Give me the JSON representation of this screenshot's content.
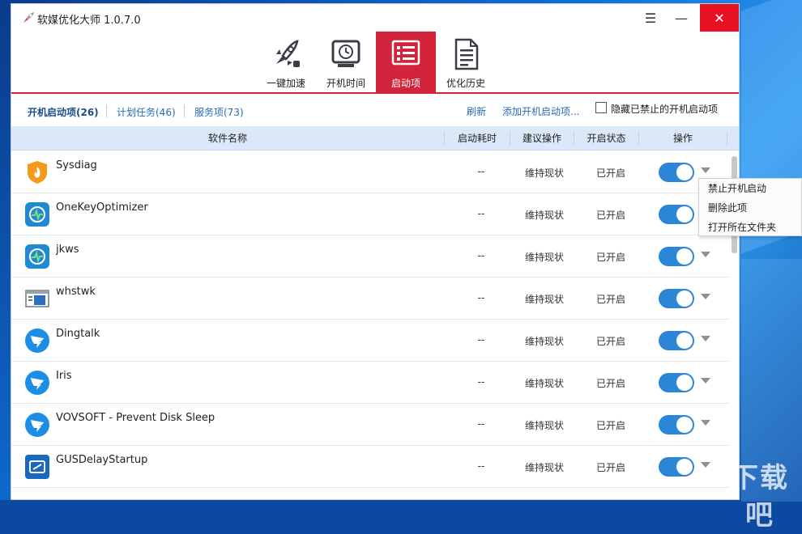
{
  "window": {
    "title": "软媒优化大师 1.0.7.0",
    "menu_glyph": "☰",
    "minimize_glyph": "—",
    "close_glyph": "✕"
  },
  "toolbar": {
    "items": [
      {
        "label": "一键加速",
        "icon": "rocket-icon"
      },
      {
        "label": "开机时间",
        "icon": "clock-icon"
      },
      {
        "label": "启动项",
        "icon": "startup-list-icon"
      },
      {
        "label": "优化历史",
        "icon": "history-document-icon"
      }
    ],
    "active_index": 2,
    "accent_color": "#d3243b"
  },
  "subtabs": {
    "items": [
      {
        "label": "开机启动项(26)"
      },
      {
        "label": "计划任务(46)"
      },
      {
        "label": "服务项(73)"
      }
    ],
    "active_index": 0,
    "refresh_label": "刷新",
    "add_label": "添加开机启动项...",
    "hide_disabled_label": "隐藏已禁止的开机启动项",
    "hide_disabled_checked": false
  },
  "table": {
    "headers": {
      "name": "软件名称",
      "time": "启动耗时",
      "advice": "建议操作",
      "state": "开启状态",
      "action": "操作"
    },
    "rows": [
      {
        "name": "Sysdiag",
        "time": "--",
        "advice": "维持现状",
        "state": "已开启",
        "enabled": true,
        "icon": "shield-flame-icon"
      },
      {
        "name": "OneKeyOptimizer",
        "time": "--",
        "advice": "维持现状",
        "state": "已开启",
        "enabled": true,
        "icon": "optimizer-icon"
      },
      {
        "name": "jkws",
        "time": "--",
        "advice": "维持现状",
        "state": "已开启",
        "enabled": true,
        "icon": "optimizer-icon"
      },
      {
        "name": "whstwk",
        "time": "--",
        "advice": "维持现状",
        "state": "已开启",
        "enabled": true,
        "icon": "window-app-icon"
      },
      {
        "name": "Dingtalk",
        "time": "--",
        "advice": "维持现状",
        "state": "已开启",
        "enabled": true,
        "icon": "dingtalk-icon"
      },
      {
        "name": "Iris",
        "time": "--",
        "advice": "维持现状",
        "state": "已开启",
        "enabled": true,
        "icon": "dingtalk-icon"
      },
      {
        "name": "VOVSOFT - Prevent Disk Sleep",
        "time": "--",
        "advice": "维持现状",
        "state": "已开启",
        "enabled": true,
        "icon": "dingtalk-icon"
      },
      {
        "name": "GUSDelayStartup",
        "time": "--",
        "advice": "维持现状",
        "state": "已开启",
        "enabled": true,
        "icon": "delay-startup-icon"
      }
    ]
  },
  "context_menu": {
    "items": [
      {
        "label": "禁止开机启动"
      },
      {
        "label": "删除此项"
      },
      {
        "label": "打开所在文件夹"
      }
    ]
  },
  "desktop": {
    "watermark": "下载吧"
  }
}
